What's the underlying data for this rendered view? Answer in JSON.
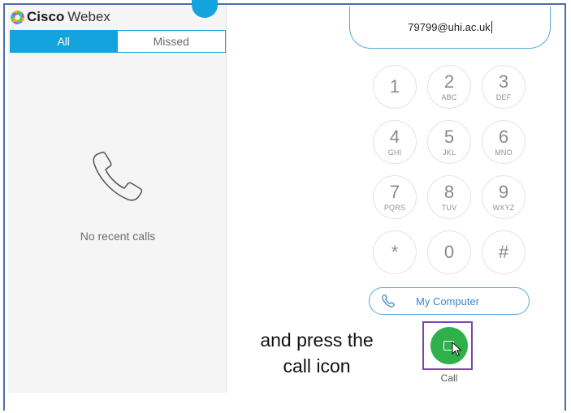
{
  "app": {
    "brand": "Cisco",
    "product": "Webex"
  },
  "tabs": [
    {
      "label": "All",
      "active": true
    },
    {
      "label": "Missed",
      "active": false
    }
  ],
  "recents": {
    "empty_text": "No recent calls",
    "icon": "phone-handset-icon"
  },
  "dialer": {
    "input_value": "79799@uhi.ac.uk",
    "keys": [
      {
        "digit": "1",
        "letters": ""
      },
      {
        "digit": "2",
        "letters": "ABC"
      },
      {
        "digit": "3",
        "letters": "DEF"
      },
      {
        "digit": "4",
        "letters": "GHI"
      },
      {
        "digit": "5",
        "letters": "JKL"
      },
      {
        "digit": "6",
        "letters": "MNO"
      },
      {
        "digit": "7",
        "letters": "PQRS"
      },
      {
        "digit": "8",
        "letters": "TUV"
      },
      {
        "digit": "9",
        "letters": "WXYZ"
      },
      {
        "digit": "*",
        "letters": ""
      },
      {
        "digit": "0",
        "letters": ""
      },
      {
        "digit": "#",
        "letters": ""
      }
    ],
    "device_label": "My Computer",
    "call_label": "Call"
  },
  "annotation": {
    "line1": "and press the",
    "line2": "call icon"
  },
  "colors": {
    "accent": "#14a4dd",
    "call_green": "#2fb04a",
    "highlight": "#7c46a8",
    "frame": "#4a6db0"
  }
}
